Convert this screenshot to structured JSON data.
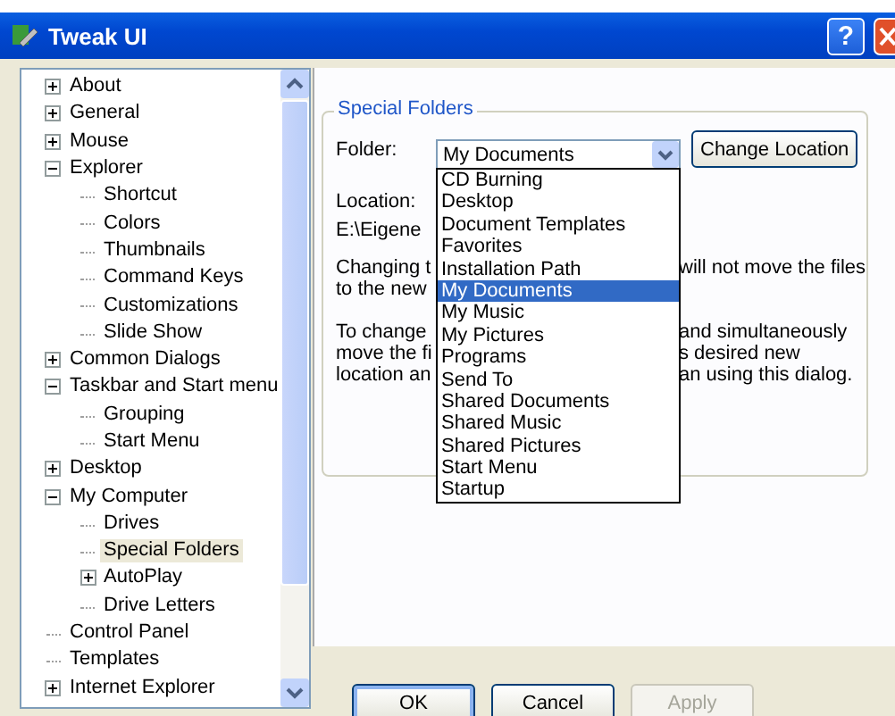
{
  "window": {
    "title": "Tweak UI",
    "help_button": "?"
  },
  "tree": [
    {
      "label": "About",
      "expanded": false,
      "selected": false
    },
    {
      "label": "General",
      "expanded": false,
      "selected": false
    },
    {
      "label": "Mouse",
      "expanded": false,
      "selected": false
    },
    {
      "label": "Explorer",
      "expanded": true,
      "selected": false,
      "children": [
        {
          "label": "Shortcut",
          "selected": false
        },
        {
          "label": "Colors",
          "selected": false
        },
        {
          "label": "Thumbnails",
          "selected": false
        },
        {
          "label": "Command Keys",
          "selected": false
        },
        {
          "label": "Customizations",
          "selected": false
        },
        {
          "label": "Slide Show",
          "selected": false
        }
      ]
    },
    {
      "label": "Common Dialogs",
      "expanded": false,
      "selected": false
    },
    {
      "label": "Taskbar and Start menu",
      "expanded": true,
      "selected": false,
      "children": [
        {
          "label": "Grouping",
          "selected": false
        },
        {
          "label": "Start Menu",
          "selected": false
        }
      ]
    },
    {
      "label": "Desktop",
      "expanded": false,
      "selected": false
    },
    {
      "label": "My Computer",
      "expanded": true,
      "selected": false,
      "children": [
        {
          "label": "Drives",
          "selected": false
        },
        {
          "label": "Special Folders",
          "selected": true
        },
        {
          "label": "AutoPlay",
          "expanded": false,
          "selected": false
        },
        {
          "label": "Drive Letters",
          "selected": false
        }
      ]
    },
    {
      "label": "Control Panel",
      "selected": false
    },
    {
      "label": "Templates",
      "selected": false
    },
    {
      "label": "Internet Explorer",
      "expanded": false,
      "selected": false
    }
  ],
  "group": {
    "title": "Special Folders",
    "folder_label": "Folder:",
    "folder_value": "My Documents",
    "change_button": "Change Location",
    "location_label": "Location:",
    "location_path": "E:\\Eigene",
    "note_1": [
      {
        "left": "Changing t",
        "right": "will not move the files"
      },
      {
        "left": "to the new"
      }
    ],
    "note_2": [
      {
        "left": "To change",
        "right": "and simultaneously"
      },
      {
        "left": "move the fi",
        "right": "s desired new"
      },
      {
        "left": "location an",
        "right": "an using this dialog."
      }
    ]
  },
  "dropdown": [
    {
      "label": "CD Burning",
      "selected": false
    },
    {
      "label": "Desktop",
      "selected": false
    },
    {
      "label": "Document Templates",
      "selected": false
    },
    {
      "label": "Favorites",
      "selected": false
    },
    {
      "label": "Installation Path",
      "selected": false
    },
    {
      "label": "My Documents",
      "selected": true
    },
    {
      "label": "My Music",
      "selected": false
    },
    {
      "label": "My Pictures",
      "selected": false
    },
    {
      "label": "Programs",
      "selected": false
    },
    {
      "label": "Send To",
      "selected": false
    },
    {
      "label": "Shared Documents",
      "selected": false
    },
    {
      "label": "Shared Music",
      "selected": false
    },
    {
      "label": "Shared Pictures",
      "selected": false
    },
    {
      "label": "Start Menu",
      "selected": false
    },
    {
      "label": "Startup",
      "selected": false
    }
  ],
  "buttons": [
    {
      "label": "OK",
      "disabled": false,
      "default": true
    },
    {
      "label": "Cancel",
      "disabled": false,
      "default": false
    },
    {
      "label": "Apply",
      "disabled": true,
      "default": false
    }
  ]
}
